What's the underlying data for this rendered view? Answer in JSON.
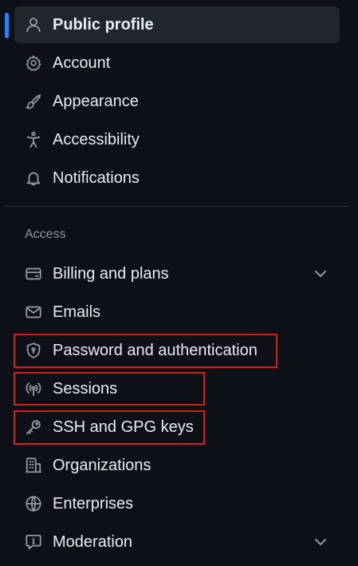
{
  "nav": {
    "top_items": [
      {
        "label": "Public profile",
        "icon": "person-icon",
        "selected": true
      },
      {
        "label": "Account",
        "icon": "gear-icon"
      },
      {
        "label": "Appearance",
        "icon": "paintbrush-icon"
      },
      {
        "label": "Accessibility",
        "icon": "accessibility-icon"
      },
      {
        "label": "Notifications",
        "icon": "bell-icon"
      }
    ],
    "access_heading": "Access",
    "access_items": [
      {
        "label": "Billing and plans",
        "icon": "credit-card-icon",
        "expandable": true
      },
      {
        "label": "Emails",
        "icon": "mail-icon"
      },
      {
        "label": "Password and authentication",
        "icon": "shield-lock-icon",
        "highlighted": true
      },
      {
        "label": "Sessions",
        "icon": "broadcast-icon",
        "highlighted": true
      },
      {
        "label": "SSH and GPG keys",
        "icon": "key-icon",
        "highlighted": true
      },
      {
        "label": "Organizations",
        "icon": "organization-icon"
      },
      {
        "label": "Enterprises",
        "icon": "globe-icon"
      },
      {
        "label": "Moderation",
        "icon": "report-icon",
        "expandable": true
      }
    ]
  },
  "colors": {
    "background": "#0d1117",
    "selected_background": "#21262d",
    "active_indicator": "#2f81f7",
    "text": "#e6edf3",
    "muted_text": "#8d96a0",
    "icon": "#9198a1",
    "highlight": "#d51f1f"
  }
}
